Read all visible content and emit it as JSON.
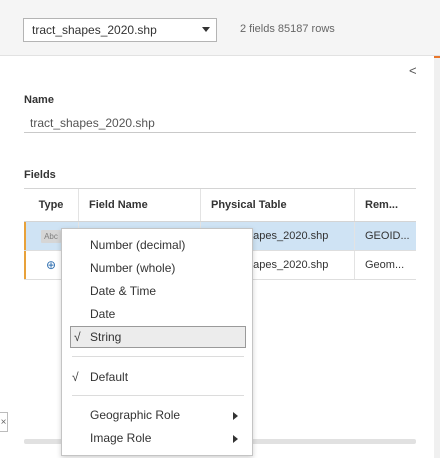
{
  "topbar": {
    "file_select": "tract_shapes_2020.shp",
    "file_info": "2 fields 85187 rows"
  },
  "panel": {
    "collapse_glyph": "<",
    "name_label": "Name",
    "name_value": "tract_shapes_2020.shp",
    "fields_label": "Fields"
  },
  "table": {
    "headers": {
      "type": "Type",
      "field_name": "Field Name",
      "physical_table": "Physical Table",
      "remote": "Rem..."
    },
    "rows": [
      {
        "type_icon": "Abc",
        "physical_table": "tract_shapes_2020.shp",
        "physical_table_visible": "hapes_2020.shp",
        "remote": "GEOID..."
      },
      {
        "type_icon": "⊕",
        "physical_table": "tract_shapes_2020.shp",
        "physical_table_visible": "hapes_2020.shp",
        "remote": "Geom..."
      }
    ]
  },
  "menu": {
    "items": {
      "number_decimal": "Number (decimal)",
      "number_whole": "Number (whole)",
      "date_time": "Date & Time",
      "date": "Date",
      "string": "String",
      "default": "Default",
      "geographic_role": "Geographic Role",
      "image_role": "Image Role"
    },
    "check_glyph": "√"
  },
  "close_glyph": "×",
  "colors": {
    "selected_row": "#cfe3f4",
    "row_accent": "#e8a13a",
    "globe": "#2f6fb0",
    "orange_accent": "#e8762b"
  }
}
